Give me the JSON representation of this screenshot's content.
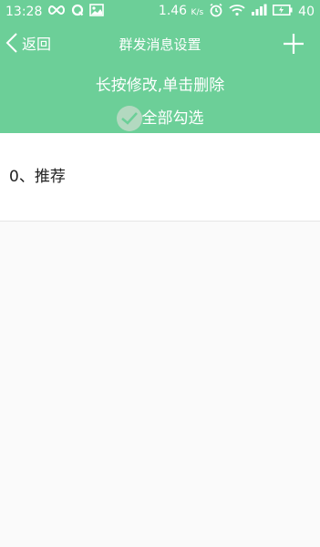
{
  "status_bar": {
    "time": "13:28",
    "speed": "1.46",
    "speed_unit": "K/s",
    "battery": "40",
    "icons_left": [
      "infinity-icon",
      "q-app-icon",
      "image-icon"
    ],
    "icons_right": [
      "alarm-icon",
      "wifi-icon",
      "signal-icon",
      "battery-icon"
    ]
  },
  "header": {
    "back_label": "返回",
    "title": "群发消息设置",
    "hint": "长按修改,单击删除",
    "select_all_label": "全部勾选"
  },
  "list": {
    "items": [
      {
        "label": "0、推荐"
      }
    ]
  },
  "colors": {
    "accent": "#6ccf98",
    "background": "#fafafa",
    "text": "#222222"
  }
}
